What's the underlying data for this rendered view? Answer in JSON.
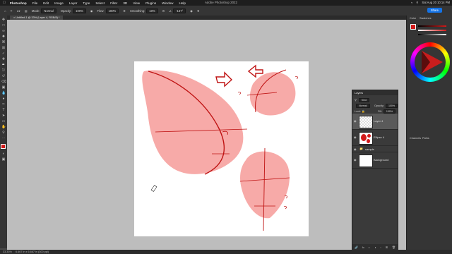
{
  "menubar": {
    "apple": "",
    "app_name": "Photoshop",
    "items": [
      "File",
      "Edit",
      "Image",
      "Layer",
      "Type",
      "Select",
      "Filter",
      "3D",
      "View",
      "Plugins",
      "Window",
      "Help"
    ],
    "window_title": "Adobe Photoshop 2022",
    "clock": "Sat Aug 20 10:14 PM"
  },
  "options": {
    "mode_label": "Mode:",
    "mode_value": "Normal",
    "opacity_label": "Opacity:",
    "opacity_value": "100%",
    "flow_label": "Flow:",
    "flow_value": "100%",
    "smoothing_label": "Smoothing:",
    "smoothing_value": "10%",
    "angle_value": "-137°",
    "share_label": "Share"
  },
  "document": {
    "tab_title": "Untitled-1 @ 33% (Layer 4, RGB/8) *"
  },
  "status": {
    "zoom": "33.33%",
    "doc_size": "6.667 in x 6.667 in (300 ppi)"
  },
  "right_panel": {
    "color_tab": "Color",
    "swatches_tab": "Swatches",
    "channels_tab": "Channels",
    "paths_tab": "Paths"
  },
  "layers_panel": {
    "title": "Layers",
    "kind_label": "Kind",
    "blend_mode": "Normal",
    "opacity_label": "Opacity:",
    "opacity_value": "100%",
    "lock_label": "Lock:",
    "fill_label": "Fill:",
    "fill_value": "100%",
    "layers": [
      {
        "name": "Layer 4",
        "selected": true
      },
      {
        "name": "Ellipse 4",
        "selected": false
      },
      {
        "name": "sample",
        "selected": false
      },
      {
        "name": "Background",
        "selected": false
      }
    ]
  },
  "colors": {
    "accent": "#1473e6",
    "foreground": "#d21a1a",
    "shape_fill": "#f7aaa8",
    "stroke": "#bf1313"
  }
}
